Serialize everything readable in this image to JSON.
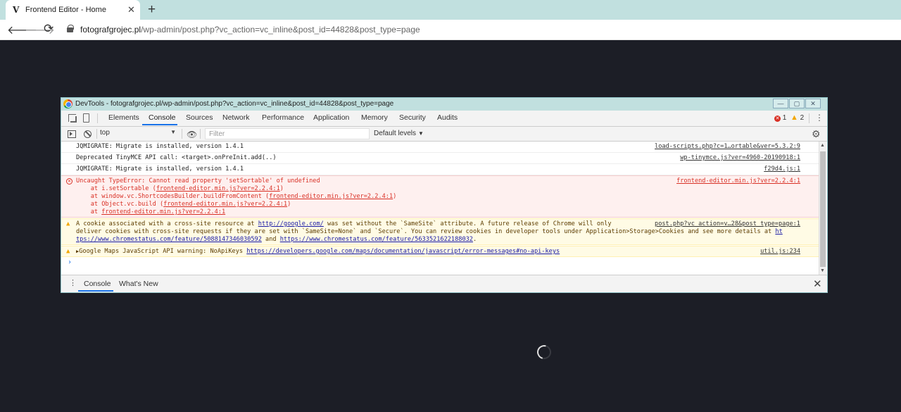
{
  "browser": {
    "tab_title": "Frontend Editor - Home",
    "tab_favicon": "V",
    "new_tab": "+",
    "url_host": "fotografgrojec.pl",
    "url_path": "/wp-admin/post.php?vc_action=vc_inline&post_id=44828&post_type=page"
  },
  "devtools": {
    "window_title": "DevTools - fotografgrojec.pl/wp-admin/post.php?vc_action=vc_inline&post_id=44828&post_type=page",
    "tabs": [
      "Elements",
      "Console",
      "Sources",
      "Network",
      "Performance",
      "Application",
      "Memory",
      "Security",
      "Audits"
    ],
    "active_tab": "Console",
    "error_count": "1",
    "warning_count": "2",
    "context": "top",
    "filter_placeholder": "Filter",
    "levels": "Default levels",
    "drawer_tabs": [
      "Console",
      "What's New"
    ]
  },
  "console": {
    "messages": [
      {
        "type": "log",
        "text": "JQMIGRATE: Migrate is installed, version 1.4.1",
        "source": "load-scripts.php?c=1…ortable&ver=5.3.2:9"
      },
      {
        "type": "log",
        "text": "Deprecated TinyMCE API call: <target>.onPreInit.add(..)",
        "source": "wp-tinymce.js?ver=4960-20190918:1"
      },
      {
        "type": "log",
        "text": "JQMIGRATE: Migrate is installed, version 1.4.1",
        "source": "f29d4.js:1"
      },
      {
        "type": "error",
        "text": "Uncaught TypeError: Cannot read property 'setSortable' of undefined",
        "source": "frontend-editor.min.js?ver=2.2.4:1",
        "stack": [
          {
            "prefix": "    at i.setSortable (",
            "link": "frontend-editor.min.js?ver=2.2.4:1",
            "suffix": ")"
          },
          {
            "prefix": "    at window.vc.ShortcodesBuilder.buildFromContent (",
            "link": "frontend-editor.min.js?ver=2.2.4:1",
            "suffix": ")"
          },
          {
            "prefix": "    at Object.vc.build (",
            "link": "frontend-editor.min.js?ver=2.2.4:1",
            "suffix": ")"
          },
          {
            "prefix": "    at ",
            "link": "frontend-editor.min.js?ver=2.2.4:1",
            "suffix": ""
          }
        ]
      },
      {
        "type": "warning",
        "line1_a": "A cookie associated with a cross-site resource at ",
        "line1_link": "http://google.com/",
        "line1_b": " was set without the `SameSite` attribute. A future release of Chrome will only",
        "line2_a": "deliver cookies with cross-site requests if they are set with `SameSite=None` and `Secure`. You can review cookies in developer tools under Application>Storage>Cookies and see more details at ",
        "line2_link": "ht",
        "line3_link1": "tps://www.chromestatus.com/feature/5088147346030592",
        "line3_mid": " and ",
        "line3_link2": "https://www.chromestatus.com/feature/5633521622188032",
        "line3_end": ".",
        "source": "post.php?vc_action=v…28&post_type=page:1"
      },
      {
        "type": "warning",
        "arrow": "▶",
        "text": "Google Maps JavaScript API warning: NoApiKeys ",
        "link": "https://developers.google.com/maps/documentation/javascript/error-messages#no-api-keys",
        "source": "util.js:234"
      }
    ],
    "prompt": "›"
  }
}
